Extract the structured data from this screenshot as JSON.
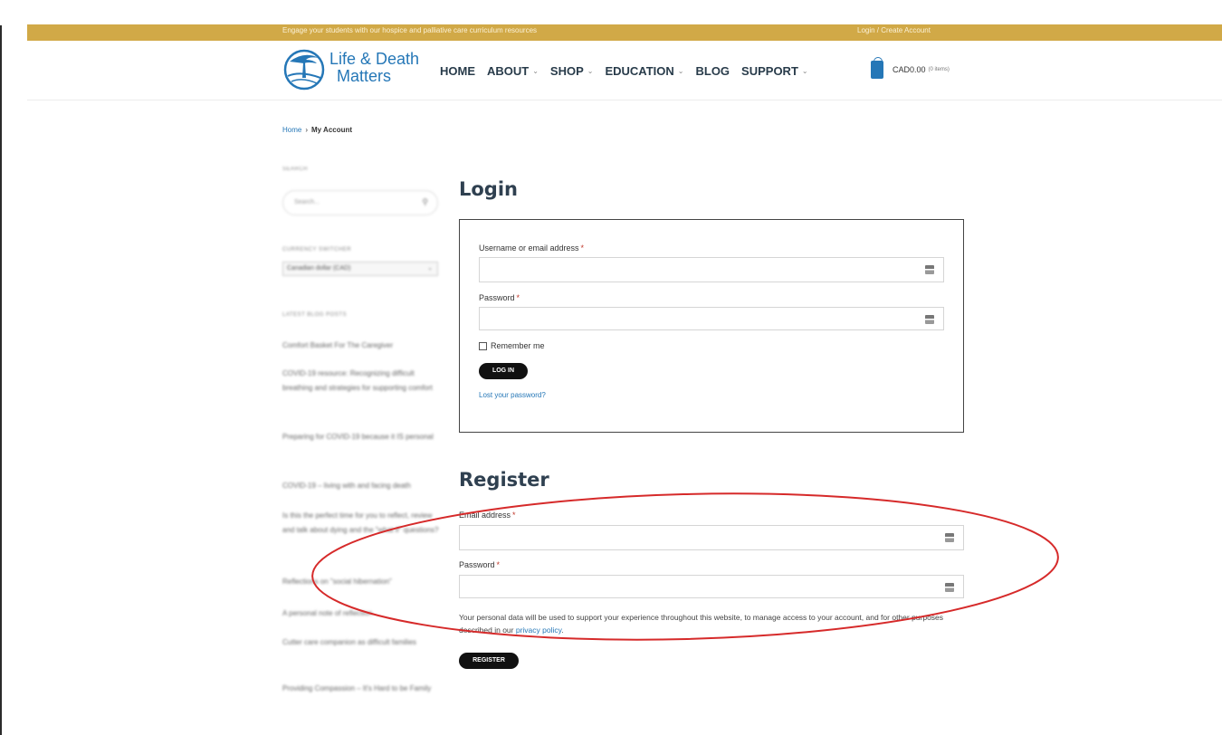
{
  "topbar": {
    "promo": "Engage your students with our hospice and palliative care curriculum resources",
    "account_link": "Login / Create Account",
    "color": "#d1a947"
  },
  "header": {
    "logo_line1": "Life & Death",
    "logo_line2": "Matters",
    "logo_icon": "tree-circle-logo",
    "nav": [
      {
        "label": "HOME",
        "has_menu": false
      },
      {
        "label": "ABOUT",
        "has_menu": true
      },
      {
        "label": "SHOP",
        "has_menu": true
      },
      {
        "label": "EDUCATION",
        "has_menu": true
      },
      {
        "label": "BLOG",
        "has_menu": false
      },
      {
        "label": "SUPPORT",
        "has_menu": true
      }
    ],
    "cart_icon": "shopping-bag-icon",
    "cart_total": "CAD0.00",
    "cart_count": "(0 items)"
  },
  "breadcrumb": {
    "home": "Home",
    "separator": "›",
    "current": "My Account"
  },
  "sidebar": {
    "search_heading": "SEARCH",
    "search_placeholder": "Search...",
    "currency_heading": "CURRENCY SWITCHER",
    "currency_value": "Canadian dollar (CAD)",
    "posts_heading": "LATEST BLOG POSTS",
    "posts": [
      "Comfort Basket For The Caregiver",
      "COVID-19 resource: Recognizing difficult breathing and strategies for supporting comfort",
      "Preparing for COVID-19 because it IS personal",
      "COVID-19 – living with and facing death",
      "Is this the perfect time for you to reflect, review and talk about dying and the \"what if\" questions?",
      "Reflections on \"social hibernation\"",
      "A personal note of reflection",
      "Cutter care companion as difficult families",
      "Providing Compassion – It's Hard to be Family"
    ]
  },
  "login": {
    "heading": "Login",
    "username_label": "Username or email address",
    "password_label": "Password",
    "required_mark": "*",
    "remember_label": "Remember me",
    "submit": "LOG IN",
    "lost_password": "Lost your password?"
  },
  "register": {
    "heading": "Register",
    "email_label": "Email address",
    "password_label": "Password",
    "required_mark": "*",
    "privacy_text": "Your personal data will be used to support your experience throughout this website, to manage access to your account, and for other purposes described in our ",
    "privacy_link": "privacy policy",
    "privacy_end": ".",
    "submit": "REGISTER"
  },
  "colors": {
    "brand_blue": "#2577b7",
    "heading": "#2f4050",
    "annotation_red": "#d62a2a"
  }
}
